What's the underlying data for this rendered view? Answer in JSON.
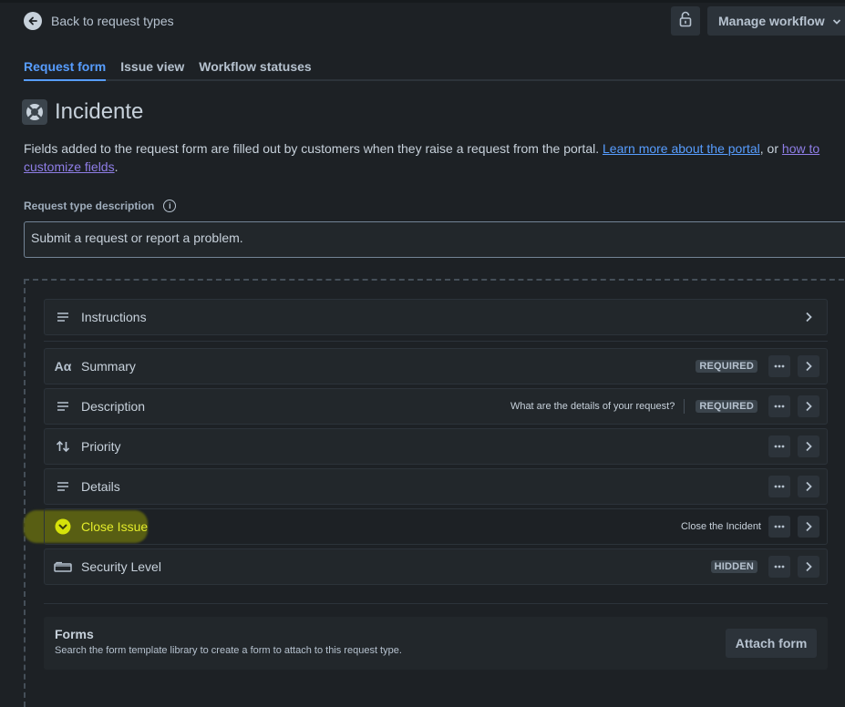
{
  "header": {
    "back_label": "Back to request types",
    "manage_label": "Manage workflow"
  },
  "tabs": [
    {
      "label": "Request form",
      "active": true
    },
    {
      "label": "Issue view",
      "active": false
    },
    {
      "label": "Workflow statuses",
      "active": false
    }
  ],
  "page": {
    "title": "Incidente",
    "intro_text": "Fields added to the request form are filled out by customers when they raise a request from the portal. ",
    "intro_link1": "Learn more about the portal",
    "intro_mid": ", or ",
    "intro_link2": "how to customize fields",
    "intro_end": "."
  },
  "description": {
    "label": "Request type description",
    "value": "Submit a request or report a problem."
  },
  "fields": [
    {
      "label": "Instructions",
      "icon": "text-lines-icon"
    },
    {
      "label": "Summary",
      "icon": "text-format-icon",
      "lozenge": "REQUIRED"
    },
    {
      "label": "Description",
      "icon": "text-lines-icon",
      "hint": "What are the details of your request?",
      "lozenge": "REQUIRED"
    },
    {
      "label": "Priority",
      "icon": "priority-arrows-icon"
    },
    {
      "label": "Details",
      "icon": "text-lines-icon"
    },
    {
      "label": "Close Issue",
      "icon": "chevron-circle-icon",
      "hint": "Close the Incident"
    },
    {
      "label": "Security Level",
      "icon": "security-level-icon",
      "lozenge": "HIDDEN"
    }
  ],
  "forms": {
    "title": "Forms",
    "subtitle": "Search the form template library to create a form to attach to this request type.",
    "attach_label": "Attach form"
  },
  "colors": {
    "accent": "#579dff",
    "link_visited": "#8f7ee7",
    "highlight": "#d6e20a",
    "background": "#1d2125"
  }
}
